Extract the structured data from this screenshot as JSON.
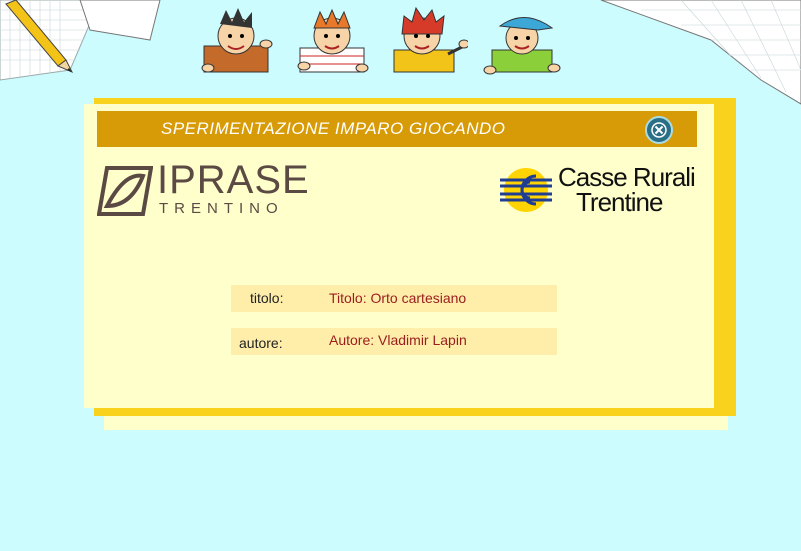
{
  "dialog": {
    "title": "SPERIMENTAZIONE IMPARO GIOCANDO"
  },
  "logos": {
    "iprase": {
      "name": "IPRASE",
      "subtitle": "TRENTINO"
    },
    "casse_rurali": {
      "line1": "Casse Rurali",
      "line2": "Trentine"
    }
  },
  "info": {
    "title_label": "titolo:",
    "title_value": "Titolo: Orto cartesiano",
    "author_label": "autore:",
    "author_value": "Autore: Vladimir Lapin"
  },
  "colors": {
    "background": "#cdfcff",
    "panel": "#ffffcc",
    "panel_border": "#f8d21c",
    "title_bar": "#d89b08",
    "value_text": "#9b1c1c"
  },
  "icons": {
    "close": "close-icon",
    "pencil": "pencil-icon",
    "graph_paper": "graph-paper-icon"
  }
}
